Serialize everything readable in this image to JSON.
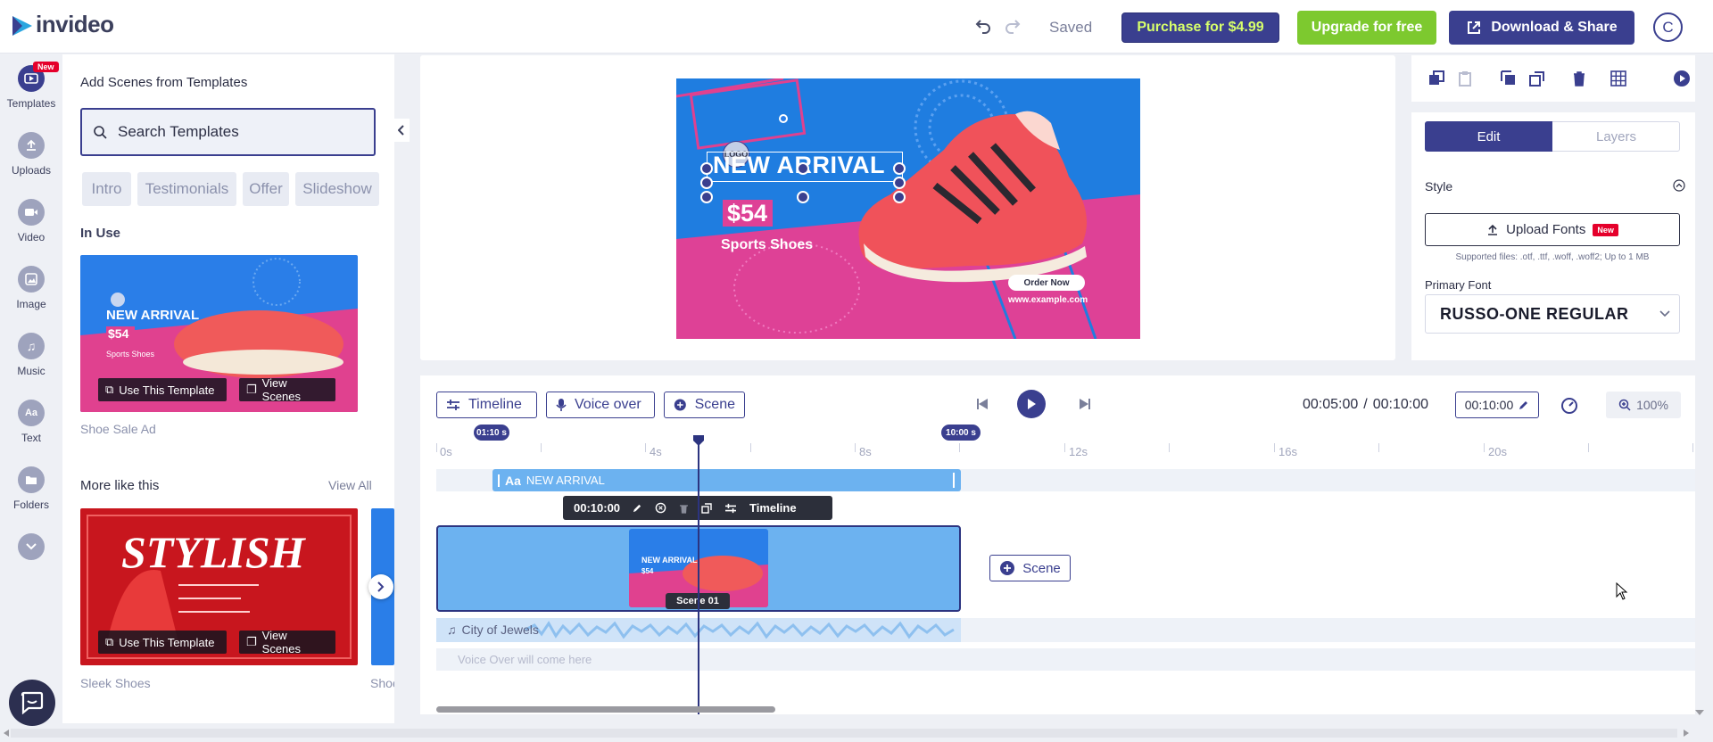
{
  "app": {
    "name": "invideo"
  },
  "header": {
    "status": "Saved",
    "purchase_label": "Purchase for $4.99",
    "upgrade_label": "Upgrade for free",
    "download_label": "Download & Share",
    "avatar_initial": "C"
  },
  "rail": {
    "new_badge": "New",
    "items": [
      {
        "label": "Templates",
        "icon": "templates-icon"
      },
      {
        "label": "Uploads",
        "icon": "upload-icon"
      },
      {
        "label": "Video",
        "icon": "video-icon"
      },
      {
        "label": "Image",
        "icon": "image-icon"
      },
      {
        "label": "Music",
        "icon": "music-icon"
      },
      {
        "label": "Text",
        "icon": "text-icon"
      },
      {
        "label": "Folders",
        "icon": "folder-icon"
      }
    ]
  },
  "panel": {
    "title": "Add Scenes from Templates",
    "search_placeholder": "Search Templates",
    "chips": [
      "Intro",
      "Testimonials",
      "Offer",
      "Slideshow"
    ],
    "in_use_heading": "In Use",
    "in_use_caption": "Shoe Sale Ad",
    "more_heading": "More like this",
    "view_all": "View All",
    "use_template": "Use This Template",
    "view_scenes": "View Scenes",
    "more_caption_1": "Sleek Shoes",
    "more_caption_2": "Shoe",
    "stylish_title": "STYLISH"
  },
  "canvas": {
    "logo": "LOGO",
    "headline": "NEW ARRIVAL",
    "price": "$54",
    "subtitle": "Sports Shoes",
    "order_now": "Order Now",
    "url": "www.example.com"
  },
  "props": {
    "tab_edit": "Edit",
    "tab_layers": "Layers",
    "style_label": "Style",
    "upload_fonts": "Upload Fonts",
    "new_badge": "New",
    "supported": "Supported files: .otf, .ttf, .woff, .woff2; Up to 1 MB",
    "primary_font_label": "Primary Font",
    "primary_font_value": "RUSSO-ONE REGULAR"
  },
  "timeline": {
    "timeline_btn": "Timeline",
    "voiceover_btn": "Voice over",
    "scene_btn": "Scene",
    "current_time": "00:05:00",
    "separator": "/",
    "total_time": "00:10:00",
    "duration_field": "00:10:00",
    "zoom": "100%",
    "start_marker": "01:10 s",
    "end_marker": "10:00 s",
    "ruler": [
      "0s",
      "4s",
      "8s",
      "12s",
      "16s",
      "20s"
    ],
    "text_track": "NEW ARRIVAL",
    "mini_duration": "00:10:00",
    "mini_timeline": "Timeline",
    "scene_label": "Scene 01",
    "add_scene": "Scene",
    "music_track": "City of Jewels",
    "voice_placeholder": "Voice Over will come here"
  },
  "colors": {
    "brand": "#3a3f8f",
    "upgrade": "#7dc92f",
    "purchase_text": "#d7ff6b",
    "badge": "#e5002b"
  }
}
